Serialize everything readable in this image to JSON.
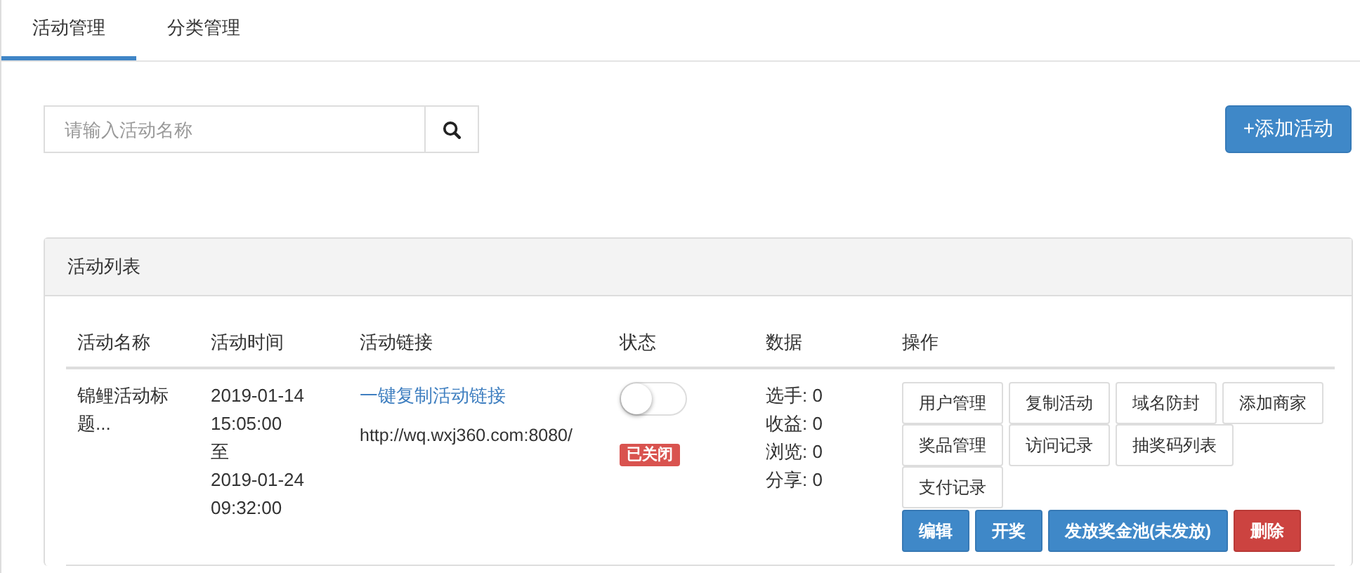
{
  "tabs": [
    {
      "label": "活动管理",
      "selected": true
    },
    {
      "label": "分类管理",
      "selected": false
    }
  ],
  "search": {
    "placeholder": "请输入活动名称"
  },
  "add_button": "+添加活动",
  "panel": {
    "title": "活动列表",
    "table": {
      "columns": [
        "活动名称",
        "活动时间",
        "活动链接",
        "状态",
        "数据",
        "操作"
      ],
      "rows": [
        {
          "name": "锦鲤活动标题...",
          "time": [
            "2019-01-14",
            "15:05:00",
            "至",
            "2019-01-24",
            "09:32:00"
          ],
          "copy_link": "一键复制活动链接",
          "url": "http://wq.wxj360.com:8080/",
          "on": false,
          "status_badge": "已关闭",
          "stats": [
            "选手: 0",
            "收益: 0",
            "浏览: 0",
            "分享: 0"
          ],
          "actions": [
            {
              "label": "用户管理",
              "kind": "default"
            },
            {
              "label": "复制活动",
              "kind": "default"
            },
            {
              "label": "域名防封",
              "kind": "default"
            },
            {
              "label": "添加商家",
              "kind": "default"
            },
            {
              "label": "奖品管理",
              "kind": "default"
            },
            {
              "label": "访问记录",
              "kind": "default"
            },
            {
              "label": "抽奖码列表",
              "kind": "default"
            },
            {
              "label": "支付记录",
              "kind": "default"
            },
            {
              "label": "编辑",
              "kind": "primary"
            },
            {
              "label": "开奖",
              "kind": "primary"
            },
            {
              "label": "发放奖金池(未发放)",
              "kind": "primary"
            },
            {
              "label": "删除",
              "kind": "danger"
            }
          ]
        }
      ]
    }
  }
}
